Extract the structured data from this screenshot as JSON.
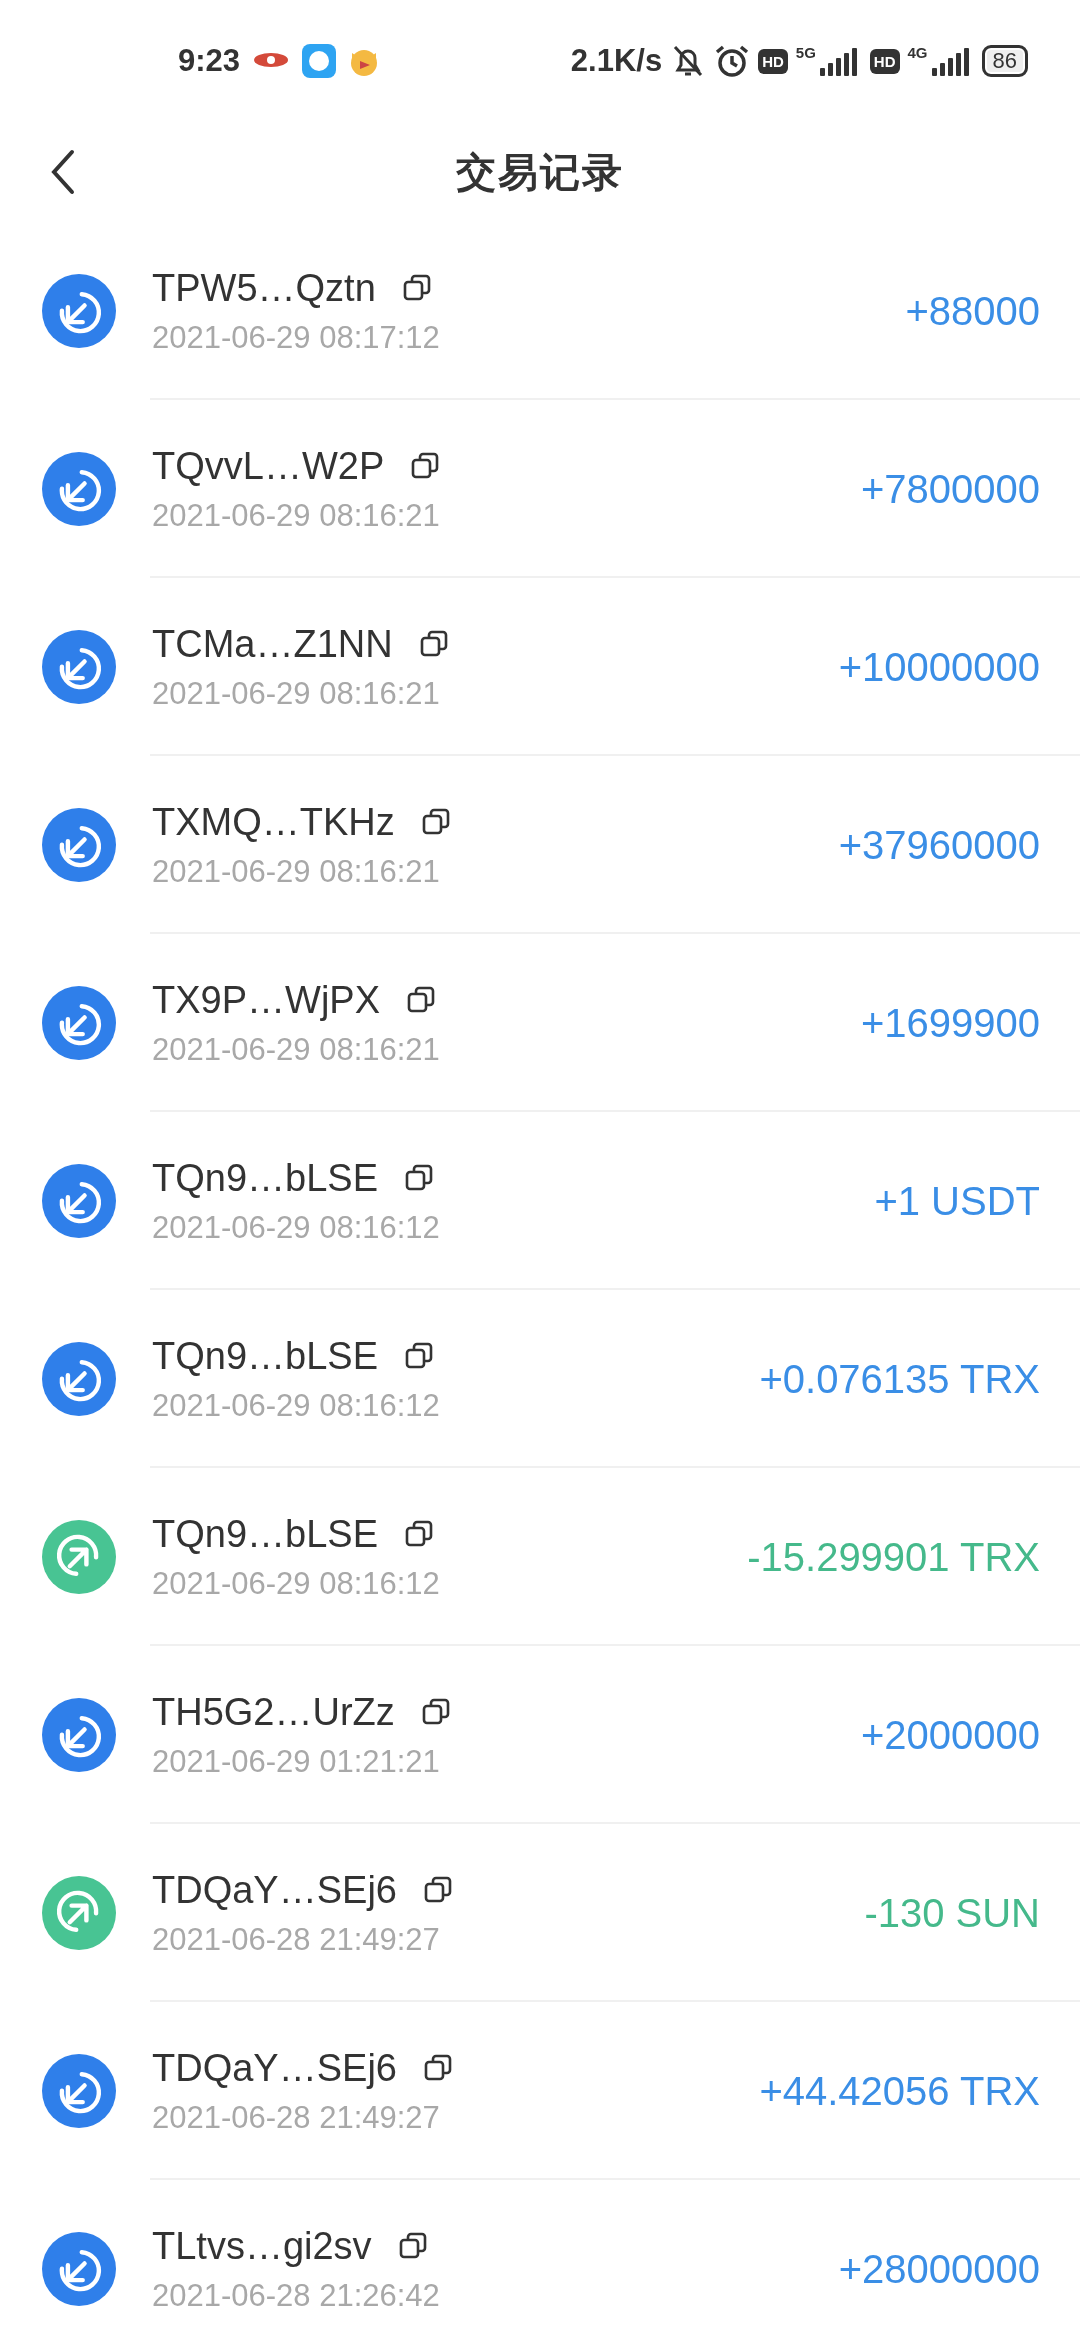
{
  "status_bar": {
    "time": "9:23",
    "speed": "2.1K/s",
    "badges": [
      "HD",
      "HD"
    ],
    "networks": [
      "5G",
      "4G"
    ],
    "battery": "86"
  },
  "header": {
    "title": "交易记录"
  },
  "transactions": [
    {
      "kind": "in",
      "address": "TPW5…Qztn",
      "time": "2021-06-29 08:17:12",
      "amount": "+88000"
    },
    {
      "kind": "in",
      "address": "TQvvL…W2P",
      "time": "2021-06-29 08:16:21",
      "amount": "+7800000"
    },
    {
      "kind": "in",
      "address": "TCMa…Z1NN",
      "time": "2021-06-29 08:16:21",
      "amount": "+10000000"
    },
    {
      "kind": "in",
      "address": "TXMQ…TKHz",
      "time": "2021-06-29 08:16:21",
      "amount": "+37960000"
    },
    {
      "kind": "in",
      "address": "TX9P…WjPX",
      "time": "2021-06-29 08:16:21",
      "amount": "+1699900"
    },
    {
      "kind": "in",
      "address": "TQn9…bLSE",
      "time": "2021-06-29 08:16:12",
      "amount": "+1 USDT"
    },
    {
      "kind": "in",
      "address": "TQn9…bLSE",
      "time": "2021-06-29 08:16:12",
      "amount": "+0.076135 TRX"
    },
    {
      "kind": "out",
      "address": "TQn9…bLSE",
      "time": "2021-06-29 08:16:12",
      "amount": "-15.299901 TRX"
    },
    {
      "kind": "in",
      "address": "TH5G2…UrZz",
      "time": "2021-06-29 01:21:21",
      "amount": "+2000000"
    },
    {
      "kind": "out",
      "address": "TDQaY…SEj6",
      "time": "2021-06-28 21:49:27",
      "amount": "-130 SUN"
    },
    {
      "kind": "in",
      "address": "TDQaY…SEj6",
      "time": "2021-06-28 21:49:27",
      "amount": "+44.42056 TRX"
    },
    {
      "kind": "in",
      "address": "TLtvs…gi2sv",
      "time": "2021-06-28 21:26:42",
      "amount": "+28000000"
    }
  ]
}
